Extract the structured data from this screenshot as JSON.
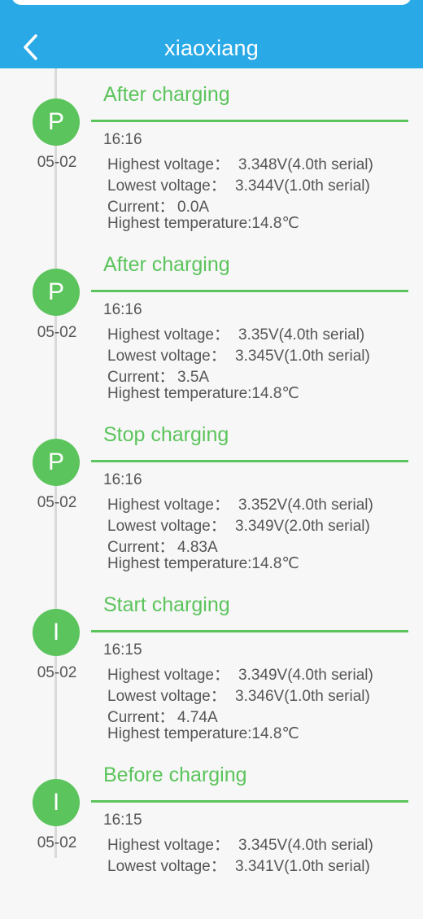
{
  "header": {
    "title": "xiaoxiang",
    "back_icon": "chevron-left-icon",
    "background_color": "#29a9e6"
  },
  "accent_color": "#5cc45c",
  "events": [
    {
      "title": "After charging",
      "marker": "P",
      "date": "05-02",
      "time": "16:16",
      "highest_voltage_label": "Highest voltage：",
      "highest_voltage": "3.348V(4.0th serial)",
      "lowest_voltage_label": "Lowest voltage：",
      "lowest_voltage": "3.344V(1.0th serial)",
      "current_label": "Current：",
      "current": "0.0A",
      "temperature_text": "Highest temperature:14.8℃"
    },
    {
      "title": "After charging",
      "marker": "P",
      "date": "05-02",
      "time": "16:16",
      "highest_voltage_label": "Highest voltage：",
      "highest_voltage": "3.35V(4.0th serial)",
      "lowest_voltage_label": "Lowest voltage：",
      "lowest_voltage": "3.345V(1.0th serial)",
      "current_label": "Current：",
      "current": "3.5A",
      "temperature_text": "Highest temperature:14.8℃"
    },
    {
      "title": "Stop charging",
      "marker": "P",
      "date": "05-02",
      "time": "16:16",
      "highest_voltage_label": "Highest voltage：",
      "highest_voltage": "3.352V(4.0th serial)",
      "lowest_voltage_label": "Lowest voltage：",
      "lowest_voltage": "3.349V(2.0th serial)",
      "current_label": "Current：",
      "current": "4.83A",
      "temperature_text": "Highest temperature:14.8℃"
    },
    {
      "title": "Start charging",
      "marker": "I",
      "date": "05-02",
      "time": "16:15",
      "highest_voltage_label": "Highest voltage：",
      "highest_voltage": "3.349V(4.0th serial)",
      "lowest_voltage_label": "Lowest voltage：",
      "lowest_voltage": "3.346V(1.0th serial)",
      "current_label": "Current：",
      "current": "4.74A",
      "temperature_text": "Highest temperature:14.8℃"
    },
    {
      "title": "Before charging",
      "marker": "I",
      "date": "05-02",
      "time": "16:15",
      "highest_voltage_label": "Highest voltage：",
      "highest_voltage": "3.345V(4.0th serial)",
      "lowest_voltage_label": "Lowest voltage：",
      "lowest_voltage": "3.341V(1.0th serial)",
      "current_label": "",
      "current": "",
      "temperature_text": ""
    }
  ]
}
